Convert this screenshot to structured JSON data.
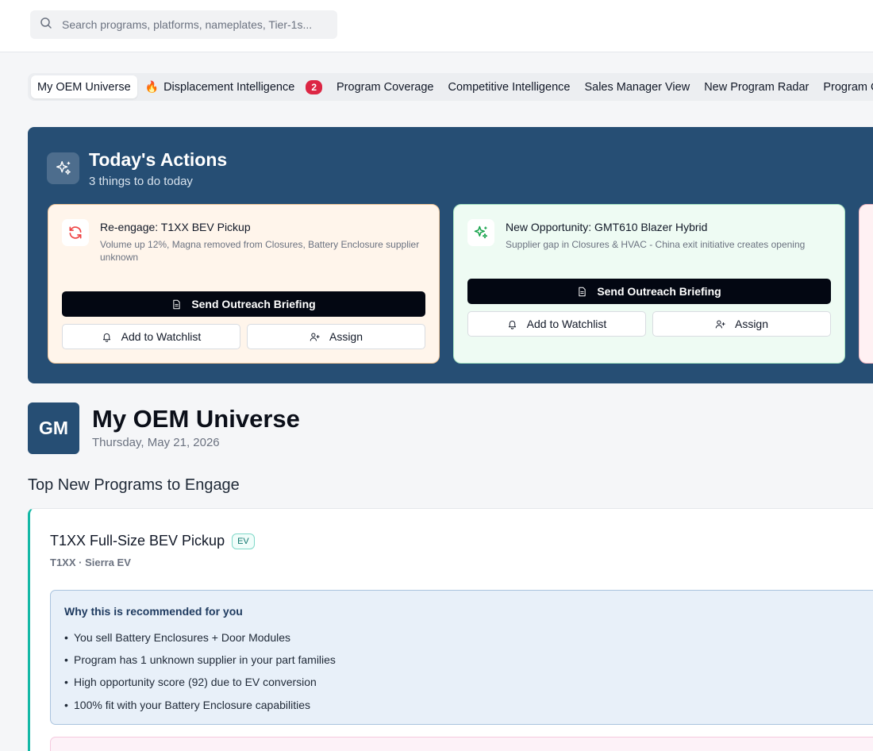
{
  "search": {
    "placeholder": "Search programs, platforms, nameplates, Tier-1s..."
  },
  "tabs": [
    {
      "label": "My OEM Universe"
    },
    {
      "label": "Displacement Intelligence",
      "icon": "flame-icon",
      "badge": "2"
    },
    {
      "label": "Program Coverage"
    },
    {
      "label": "Competitive Intelligence"
    },
    {
      "label": "Sales Manager View"
    },
    {
      "label": "New Program Radar"
    },
    {
      "label": "Program C"
    }
  ],
  "actions": {
    "title": "Today's Actions",
    "subtitle": "3 things to do today",
    "cards": [
      {
        "title": "Re-engage: T1XX BEV Pickup",
        "description": "Volume up 12%, Magna removed from Closures, Battery Enclosure supplier unknown",
        "primary_button": "Send Outreach Briefing",
        "watchlist_button": "Add to Watchlist",
        "assign_button": "Assign",
        "icon": "refresh-icon"
      },
      {
        "title": "New Opportunity: GMT610 Blazer Hybrid",
        "description": "Supplier gap in Closures & HVAC - China exit initiative creates opening",
        "primary_button": "Send Outreach Briefing",
        "watchlist_button": "Add to Watchlist",
        "assign_button": "Assign",
        "icon": "sparkles-icon"
      }
    ]
  },
  "header": {
    "avatar": "GM",
    "title": "My OEM Universe",
    "date": "Thursday, May 21, 2026"
  },
  "section": {
    "title": "Top New Programs to Engage"
  },
  "program": {
    "title": "T1XX Full-Size BEV Pickup",
    "tag": "EV",
    "subtitle": "T1XX · Sierra EV",
    "why_title": "Why this is recommended for you",
    "reasons": [
      "You sell Battery Enclosures + Door Modules",
      "Program has 1 unknown supplier in your part families",
      "High opportunity score (92) due to EV conversion",
      "100% fit with your Battery Enclosure capabilities"
    ]
  },
  "colors": {
    "panel": "#264e74",
    "accent_teal": "#14b8a6",
    "badge_red": "#dc2644"
  }
}
